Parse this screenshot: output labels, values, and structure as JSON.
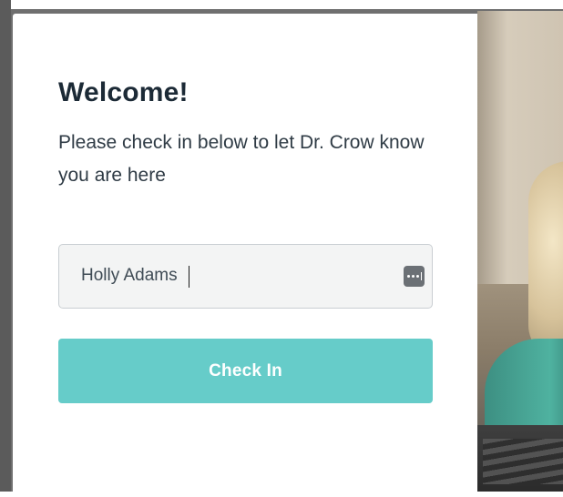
{
  "modal": {
    "title": "Welcome!",
    "subtitle": "Please check in below to let Dr. Crow know you are here",
    "name_field": {
      "value": "Holly Adams",
      "placeholder": ""
    },
    "checkin_button_label": "Check In",
    "icons": {
      "password_manager": "password-manager-icon"
    }
  },
  "colors": {
    "accent": "#66ccc9",
    "title_text": "#1c2a36",
    "body_text": "#2f3b45",
    "input_bg": "#f3f4f4",
    "input_border": "#c9ced2"
  }
}
